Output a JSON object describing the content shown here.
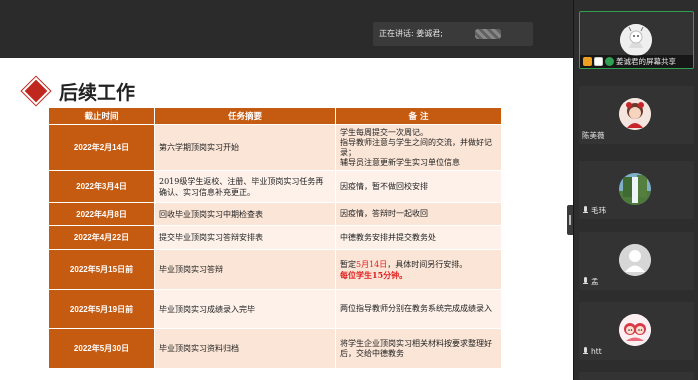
{
  "share": {
    "speaking_label": "正在讲话: 姜诚君;"
  },
  "slide": {
    "title": "后续工作",
    "table": {
      "headers": [
        "截止时间",
        "任务摘要",
        "备  注"
      ],
      "rows": [
        {
          "date": "2022年2月14日",
          "task": "第六学期顶岗实习开始",
          "note": [
            "学生每周提交一次周记。",
            "指导教师注意与学生之间的交流，并做好记录；",
            "辅导员注意更新学生实习单位信息"
          ]
        },
        {
          "date": "2022年3月4日",
          "task": "2019级学生返校、注册、毕业顶岗实习任务再确认、实习信息补充更正。",
          "note": [
            "因疫情，暂不做回校安排"
          ]
        },
        {
          "date": "2022年4月8日",
          "task": "回收毕业顶岗实习中期检查表",
          "note": [
            "因疫情，答辩时一起收回"
          ]
        },
        {
          "date": "2022年4月22日",
          "task": "提交毕业顶岗实习答辩安排表",
          "note": [
            "中德教务安排并提交教务处"
          ]
        },
        {
          "date": "2022年5月15日前",
          "task": "毕业顶岗实习答辩",
          "note_prefix": "暂定",
          "note_red": "5月14日",
          "note_suffix": "，具体时间另行安排。",
          "note_bold": "每位学生15分钟。"
        },
        {
          "date": "2022年5月19日前",
          "task": "毕业顶岗实习成绩录入完毕",
          "note": [
            "两位指导教师分别在教务系统完成成绩录入"
          ]
        },
        {
          "date": "2022年5月30日",
          "task": "毕业顶岗实习资料归档",
          "note": [
            "将学生企业顶岗实习相关材料按要求整理好后，交给中德教务"
          ]
        }
      ]
    }
  },
  "participants": [
    {
      "name": "姜诚君的屏幕共享",
      "active": true,
      "avatar": "cartoon-figure-avatar"
    },
    {
      "name": "陈美薇",
      "active": false,
      "avatar": "cartoon-girl-avatar"
    },
    {
      "name": "毛玮",
      "active": false,
      "avatar": "waterfall-avatar"
    },
    {
      "name": "孟",
      "active": false,
      "avatar": "default-person-avatar"
    },
    {
      "name": "htt",
      "active": false,
      "avatar": "cartoon-couple-avatar"
    }
  ],
  "colors": {
    "accent": "#c55a11",
    "diamond": "#c0271f",
    "active_border": "#2ea04f",
    "highlight_red": "#e02020"
  }
}
